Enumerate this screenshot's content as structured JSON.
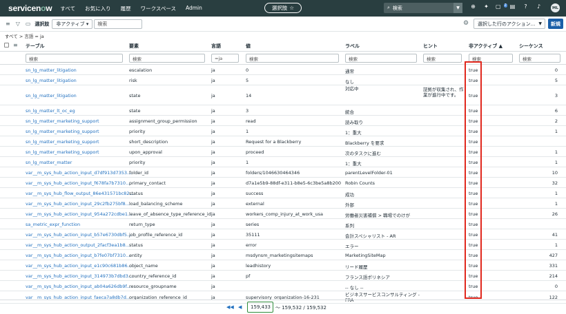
{
  "topbar": {
    "logo_main": "servicen",
    "logo_o": "o",
    "logo_end": "w",
    "links": [
      "すべて",
      "お気に入り",
      "履歴",
      "ワークスペース",
      "Admin"
    ],
    "pill_label": "選択肢",
    "search_placeholder": "検索",
    "avatar": "ML",
    "badge_count": "2"
  },
  "toolbar": {
    "field_label": "選択肢",
    "field_select": "非アクティブ",
    "search_placeholder": "検索",
    "action_select": "選択した行のアクション...",
    "new_button": "新規"
  },
  "breadcrumb": "すべて > 言語 = ja",
  "columns": [
    "テーブル",
    "要素",
    "言語",
    "値",
    "ラベル",
    "ヒント",
    "非アクティブ ▲",
    "シーケンス"
  ],
  "filters": {
    "table": "検索",
    "element": "検索",
    "language": "=ja",
    "value": "検索",
    "label": "検索",
    "hint": "検索",
    "inactive": "検索",
    "sequence": "検索"
  },
  "rows": [
    {
      "table": "sn_lg_matter_litigation",
      "element": "escalation",
      "lang": "ja",
      "value": "0",
      "label": "通常",
      "hint": "",
      "inactive": "true",
      "seq": "0"
    },
    {
      "table": "sn_lg_matter_litigation",
      "element": "risk",
      "lang": "ja",
      "value": "5",
      "label": "なし",
      "hint": "",
      "inactive": "true",
      "seq": "5"
    },
    {
      "table": "sn_lg_matter_litigation",
      "element": "state",
      "lang": "ja",
      "value": "14",
      "label": "対応中",
      "hint": "証拠が収集され、作業が進行中です。",
      "inactive": "true",
      "seq": "3"
    },
    {
      "table": "sn_lg_matter_lt_oc_eg",
      "element": "state",
      "lang": "ja",
      "value": "3",
      "label": "統合",
      "hint": "",
      "inactive": "true",
      "seq": "6"
    },
    {
      "table": "sn_lg_matter_marketing_support",
      "element": "assignment_group_permission",
      "lang": "ja",
      "value": "read",
      "label": "読み取り",
      "hint": "",
      "inactive": "true",
      "seq": "2"
    },
    {
      "table": "sn_lg_matter_marketing_support",
      "element": "priority",
      "lang": "ja",
      "value": "1",
      "label": "1：重大",
      "hint": "",
      "inactive": "true",
      "seq": "1"
    },
    {
      "table": "sn_lg_matter_marketing_support",
      "element": "short_description",
      "lang": "ja",
      "value": "Request for a Blackberry",
      "label": "Blackberry を要求",
      "hint": "",
      "inactive": "true",
      "seq": ""
    },
    {
      "table": "sn_lg_matter_marketing_support",
      "element": "upon_approval",
      "lang": "ja",
      "value": "proceed",
      "label": "次のタスクに進む",
      "hint": "",
      "inactive": "true",
      "seq": "1"
    },
    {
      "table": "sn_lg_matter_matter",
      "element": "priority",
      "lang": "ja",
      "value": "1",
      "label": "1：重大",
      "hint": "",
      "inactive": "true",
      "seq": "1"
    },
    {
      "table": "var__m_sys_hub_action_input_d7df913d7353...",
      "element": "folder_id",
      "lang": "ja",
      "value": "folders/1046630464346",
      "label": "parentLevelFolder-01",
      "hint": "",
      "inactive": "true",
      "seq": "10"
    },
    {
      "table": "var__m_sys_hub_action_input_f678fa7b7310...",
      "element": "primary_contact",
      "lang": "ja",
      "value": "d7a1e5b9-88df-e311-b8e5-6c3be5a8b200",
      "label": "Robin Counts",
      "hint": "",
      "inactive": "true",
      "seq": "32"
    },
    {
      "table": "var__m_sys_hub_flow_output_86e431571bc82...",
      "element": "status",
      "lang": "ja",
      "value": "success",
      "label": "成功",
      "hint": "",
      "inactive": "true",
      "seq": "1"
    },
    {
      "table": "var__m_sys_hub_action_input_29c2fb275bf8...",
      "element": "load_balancing_scheme",
      "lang": "ja",
      "value": "external",
      "label": "外部",
      "hint": "",
      "inactive": "true",
      "seq": "1"
    },
    {
      "table": "var__m_sys_hub_action_input_954a272cdbe1...",
      "element": "leave_of_absence_type_reference_id",
      "lang": "ja",
      "value": "workers_comp_injury_at_work_usa",
      "label": "労働者災害補償 > 職場でのけが",
      "hint": "",
      "inactive": "true",
      "seq": "26"
    },
    {
      "table": "sa_metric_expr_function",
      "element": "return_type",
      "lang": "ja",
      "value": "series",
      "label": "系列",
      "hint": "",
      "inactive": "true",
      "seq": ""
    },
    {
      "table": "var__m_sys_hub_action_input_b57e6730dbf5...",
      "element": "job_profile_reference_id",
      "lang": "ja",
      "value": "35111",
      "label": "会計スペシャリスト - AR",
      "hint": "",
      "inactive": "true",
      "seq": "41"
    },
    {
      "table": "var__m_sys_hub_action_output_2facf3ea1b8...",
      "element": "status",
      "lang": "ja",
      "value": "error",
      "label": "エラー",
      "hint": "",
      "inactive": "true",
      "seq": "1"
    },
    {
      "table": "var__m_sys_hub_action_input_b7fe07bf7310...",
      "element": "entity",
      "lang": "ja",
      "value": "msdynsm_marketingsitemaps",
      "label": "MarketingSiteMap",
      "hint": "",
      "inactive": "true",
      "seq": "427"
    },
    {
      "table": "var__m_sys_hub_action_input_e1c90c681b86...",
      "element": "object_name",
      "lang": "ja",
      "value": "leadhistory",
      "label": "リード履歴",
      "hint": "",
      "inactive": "true",
      "seq": "331"
    },
    {
      "table": "var__m_sys_hub_action_input_314973b7dbd3...",
      "element": "country_reference_id",
      "lang": "ja",
      "value": "pf",
      "label": "フランス語ポリネシア",
      "hint": "",
      "inactive": "true",
      "seq": "214"
    },
    {
      "table": "var__m_sys_hub_action_input_ab04a626db9f...",
      "element": "resource_groupname",
      "lang": "ja",
      "value": "",
      "label": "-- なし --",
      "hint": "",
      "inactive": "true",
      "seq": "0"
    },
    {
      "table": "var__m_sys_hub_action_input_faeca7a8db7d...",
      "element": "organization_reference_id",
      "lang": "ja",
      "value": "supervisory_organization-16-231",
      "label": "ビジネスサービスコンサルティング - FRA",
      "hint": "",
      "inactive": "true",
      "seq": "122"
    }
  ],
  "pagination": {
    "current": "159,433",
    "range_text": "〜 159,532 / 159,532"
  }
}
